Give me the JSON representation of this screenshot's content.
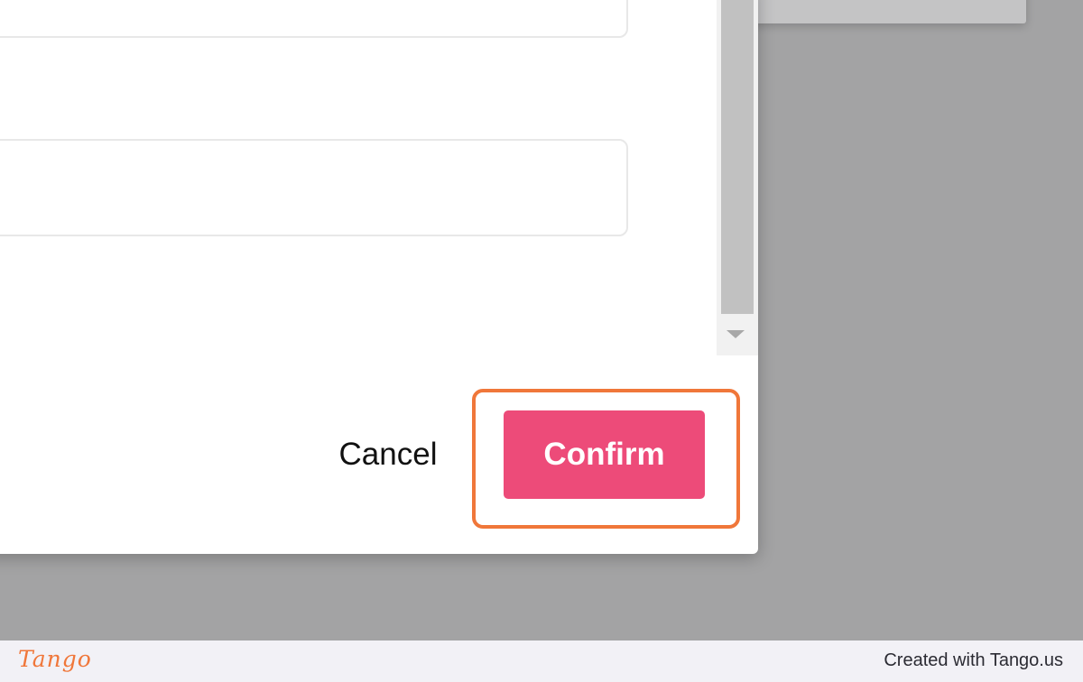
{
  "dialog": {
    "cancel_label": "Cancel",
    "confirm_label": "Confirm"
  },
  "footer": {
    "logo_text": "Tango",
    "credit_text": "Created with Tango.us"
  },
  "colors": {
    "confirm": "#ed4b79",
    "highlight": "#f0773a",
    "overlay": "#a3a3a4"
  },
  "icons": {
    "scroll_down": "triangle-down-icon"
  }
}
